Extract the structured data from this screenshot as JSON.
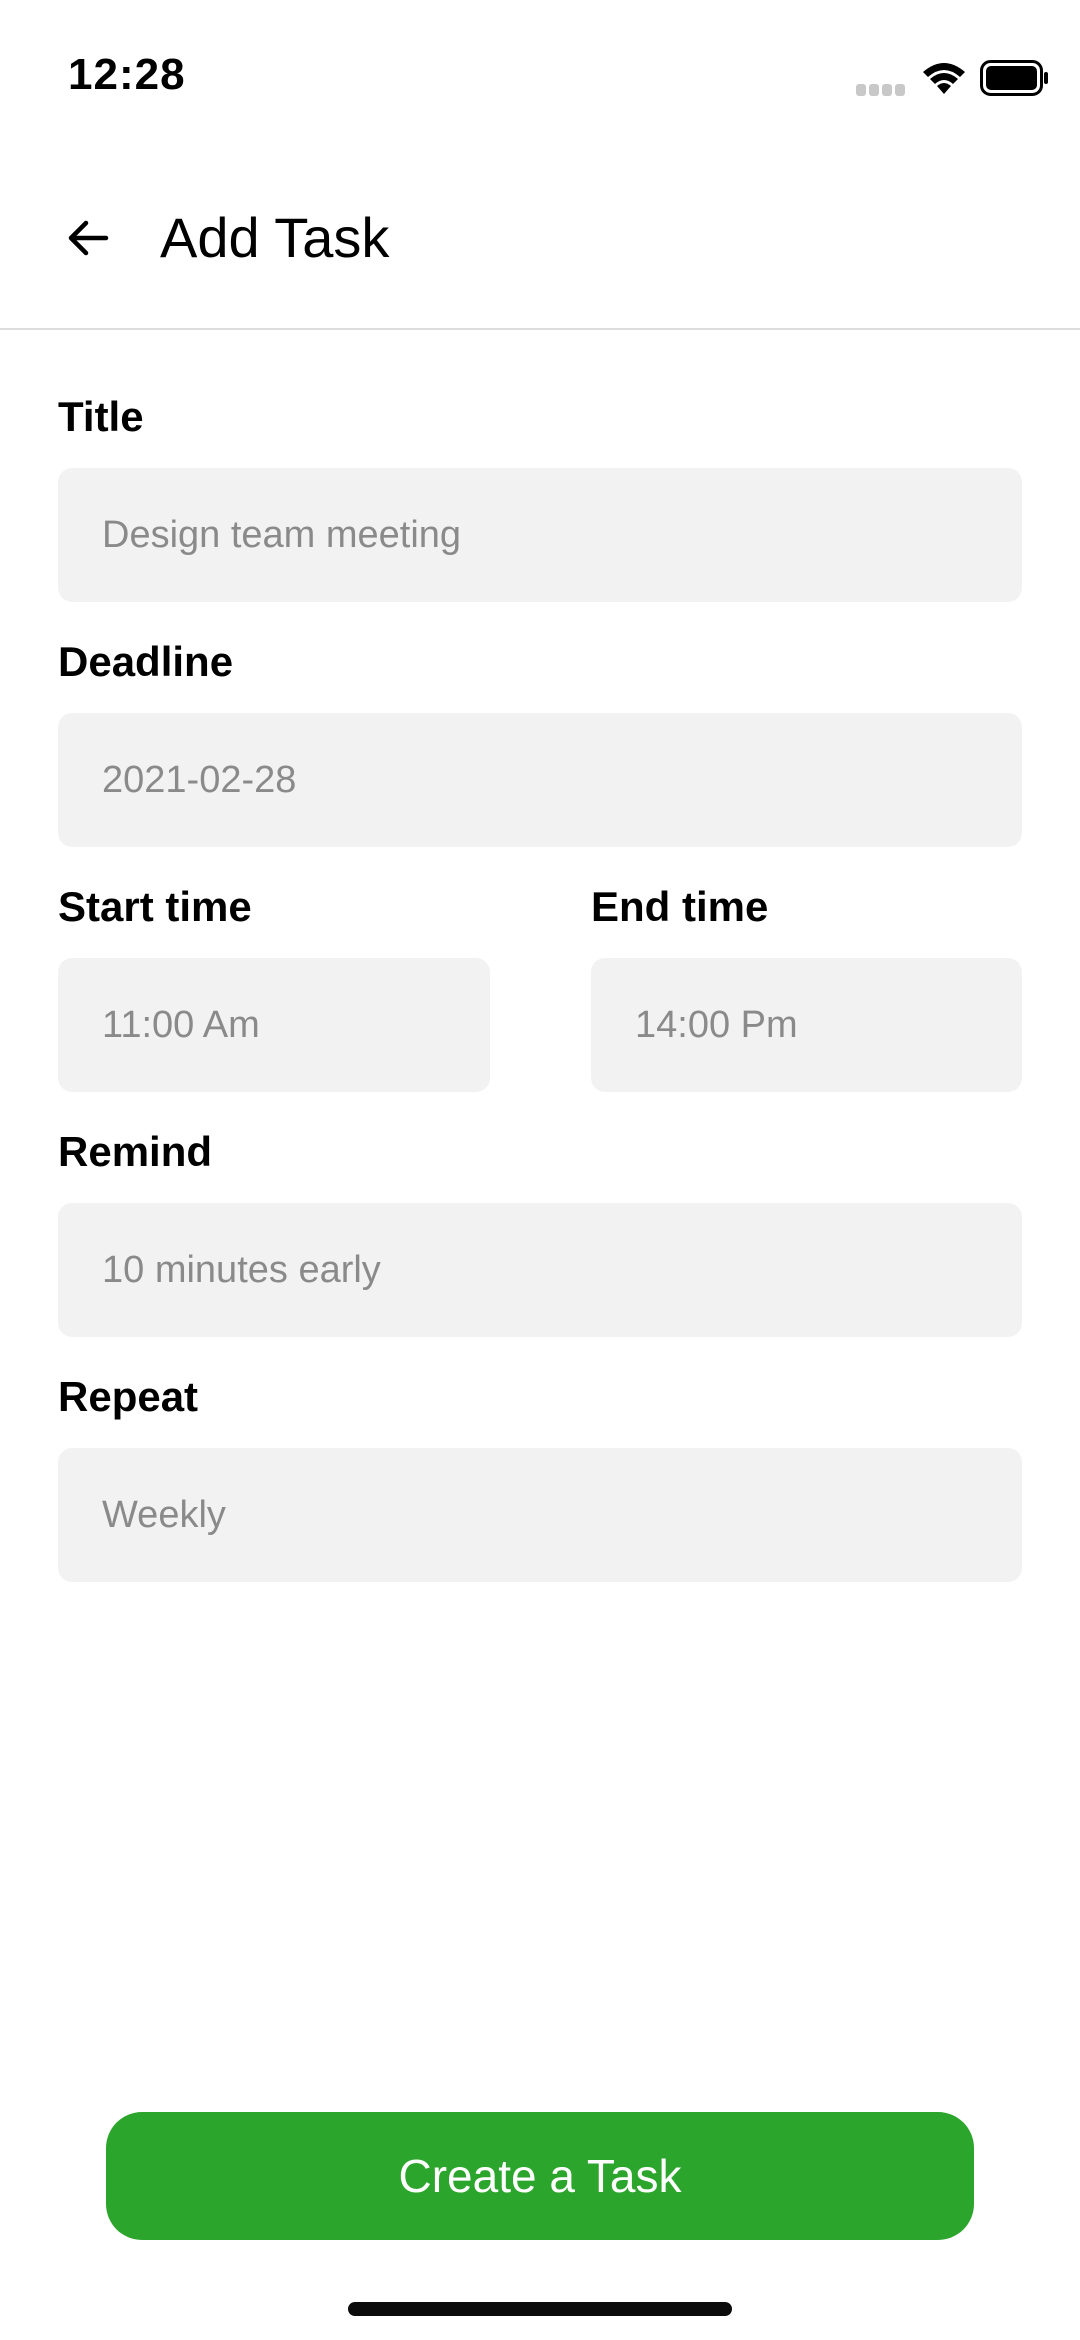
{
  "status_bar": {
    "time": "12:28",
    "icons": [
      "cellular-signal-icon",
      "wifi-icon",
      "battery-icon"
    ]
  },
  "header": {
    "back_icon": "arrow-left-icon",
    "title": "Add Task"
  },
  "form": {
    "title": {
      "label": "Title",
      "placeholder": "Design team meeting"
    },
    "deadline": {
      "label": "Deadline",
      "placeholder": "2021-02-28"
    },
    "start_time": {
      "label": "Start time",
      "placeholder": "11:00 Am"
    },
    "end_time": {
      "label": "End time",
      "placeholder": "14:00 Pm"
    },
    "remind": {
      "label": "Remind",
      "placeholder": "10 minutes early"
    },
    "repeat": {
      "label": "Repeat",
      "placeholder": "Weekly"
    }
  },
  "actions": {
    "create_label": "Create a Task"
  },
  "colors": {
    "accent": "#2ca52c",
    "input_bg": "#f2f2f2",
    "placeholder": "#8a8a8a",
    "divider": "#dcdcdc"
  }
}
